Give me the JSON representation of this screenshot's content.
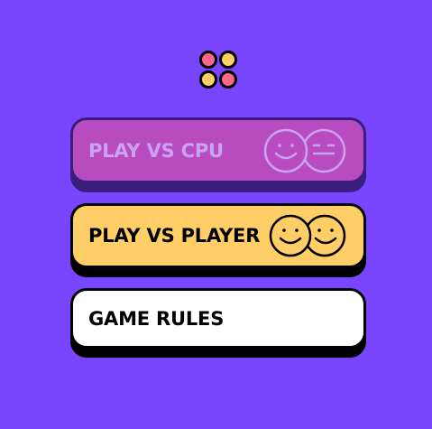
{
  "logo": {
    "icon": "connect-four-logo-icon",
    "colors": [
      "#FD6687",
      "#FFCE67"
    ]
  },
  "menu": {
    "play_cpu_label": "PLAY VS CPU",
    "play_player_label": "PLAY VS PLAYER",
    "rules_label": "GAME RULES"
  },
  "colors": {
    "background": "#7945FF",
    "cpu_button": "#B84BC0",
    "player_button": "#FFCE67",
    "rules_button": "#FFFFFF"
  }
}
